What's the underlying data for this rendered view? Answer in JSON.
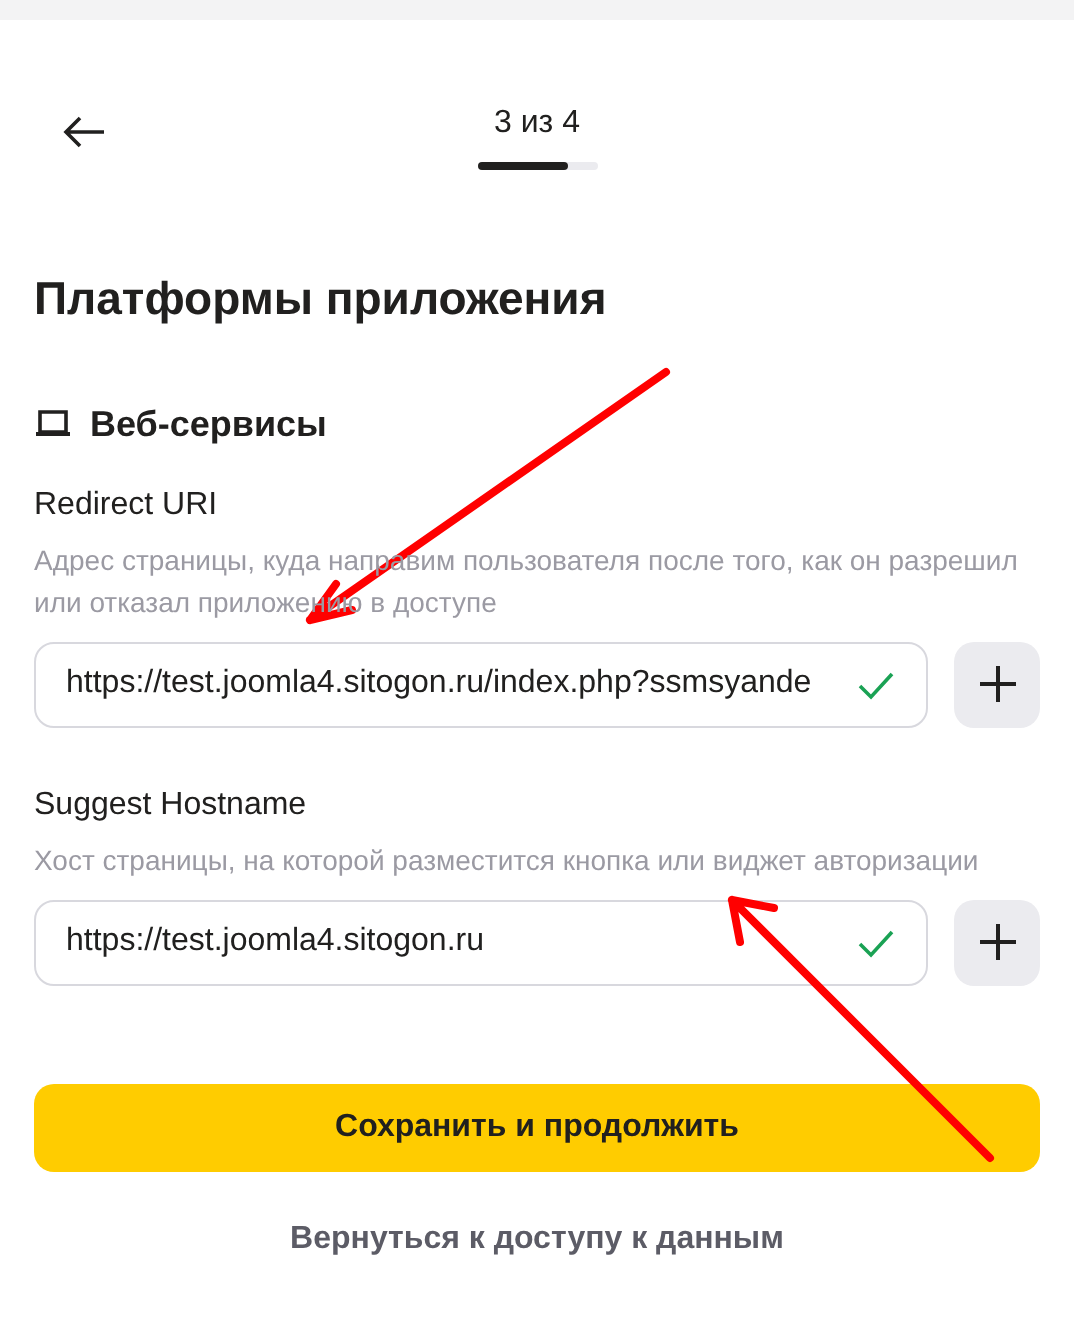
{
  "header": {
    "step": "3 из 4",
    "progress": {
      "level": 0.75
    }
  },
  "title": "Платформы приложения",
  "section": {
    "title": "Веб-сервисы"
  },
  "fields": [
    {
      "label": "Redirect URI",
      "hint": "Адрес страницы, куда направим пользователя после того, как он разрешил или отказал приложению в доступе",
      "value": "https://test.joomla4.sitogon.ru/index.php?ssmsyande",
      "valid": true
    },
    {
      "label": "Suggest Hostname",
      "hint": "Хост страницы, на которой разместится кнопка или виджет авторизации",
      "value": "https://test.joomla4.sitogon.ru",
      "valid": true
    }
  ],
  "primary_button": "Сохранить и продолжить",
  "secondary_link": "Вернуться к доступу к данным"
}
